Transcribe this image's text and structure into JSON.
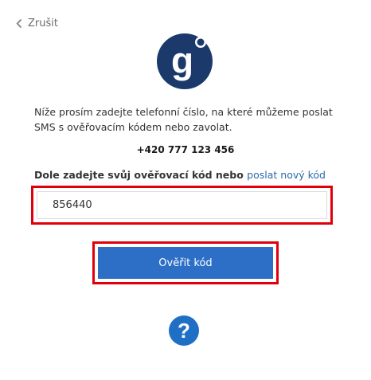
{
  "header": {
    "cancel_label": "Zrušit"
  },
  "logo": {
    "letter": "g",
    "brand_color": "#1b3a6b"
  },
  "instructions": {
    "line1": "Níže prosím zadejte telefonní číslo, na které můžeme poslat",
    "line2": "SMS s ověřovacím kódem nebo zavolat."
  },
  "phone_number": "+420 777 123 456",
  "code": {
    "label": "Dole zadejte svůj ověřovací kód nebo",
    "resend_link": "poslat nový kód",
    "value": "856440"
  },
  "verify_button": {
    "label": "Ověřit kód",
    "color": "#2d6fc7"
  },
  "help": {
    "glyph": "?",
    "color": "#1f6fc5"
  },
  "highlight_color": "#e0000b"
}
